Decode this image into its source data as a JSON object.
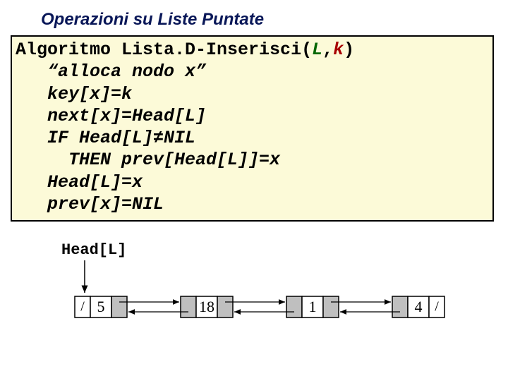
{
  "title": "Operazioni su Liste Puntate",
  "code": {
    "l1a": "Algoritmo Lista.D-Inserisci(",
    "l1L": "L",
    "l1c": ",",
    "l1k": "k",
    "l1b": ")",
    "l2": "   “alloca nodo x”",
    "l3": "   key[x]=k",
    "l4": "   next[x]=Head[L]",
    "l5": "   IF Head[L]≠NIL",
    "l6": "     THEN prev[Head[L]]=x",
    "l7": "   Head[L]=x",
    "l8": "   prev[x]=NIL"
  },
  "head_label": "Head[L]",
  "nodes": [
    {
      "value": "5",
      "prev_nil": true,
      "next_nil": false
    },
    {
      "value": "18",
      "prev_nil": false,
      "next_nil": false
    },
    {
      "value": "1",
      "prev_nil": false,
      "next_nil": false
    },
    {
      "value": "4",
      "prev_nil": false,
      "next_nil": true
    }
  ]
}
